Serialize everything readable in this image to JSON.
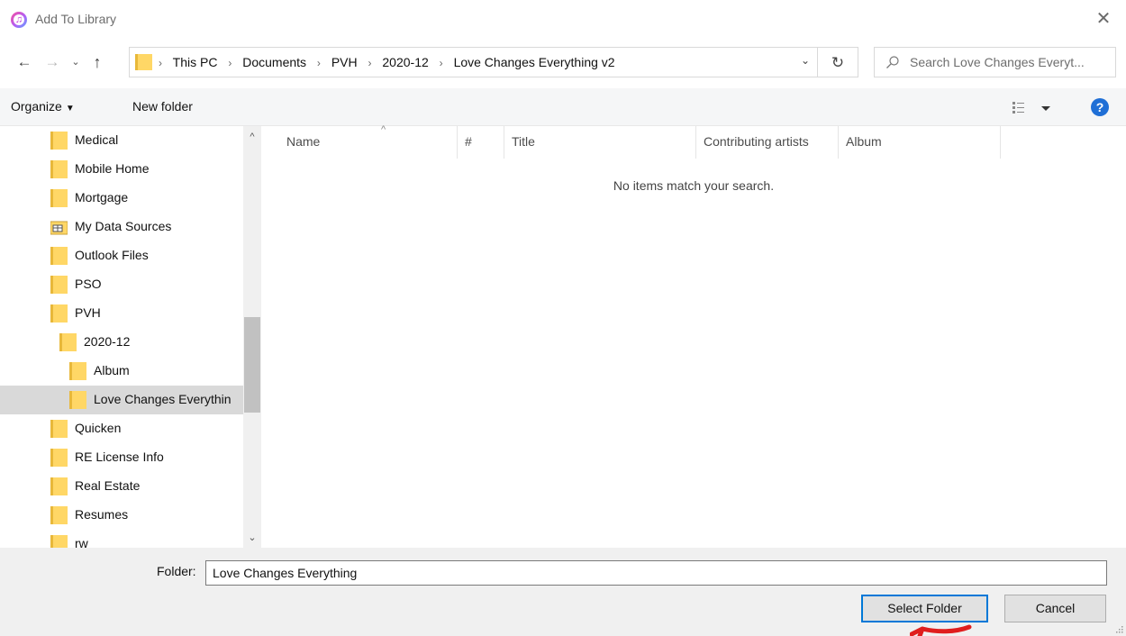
{
  "window": {
    "title": "Add To Library",
    "close_glyph": "✕"
  },
  "nav": {
    "back_glyph": "←",
    "forward_glyph": "→",
    "recent_glyph": "⌄",
    "up_glyph": "↑",
    "breadcrumbs": [
      "This PC",
      "Documents",
      "PVH",
      "2020-12",
      "Love Changes Everything v2"
    ],
    "refresh_glyph": "↻",
    "search_placeholder": "Search Love Changes Everyt..."
  },
  "toolbar": {
    "organize_label": "Organize",
    "new_folder_label": "New folder",
    "help_glyph": "?"
  },
  "tree": {
    "items": [
      {
        "label": "Medical",
        "icon": "folder-icon"
      },
      {
        "label": "Mobile Home",
        "icon": "folder-icon"
      },
      {
        "label": "Mortgage",
        "icon": "folder-icon"
      },
      {
        "label": "My Data Sources",
        "icon": "data-sources-folder-icon"
      },
      {
        "label": "Outlook Files",
        "icon": "folder-icon"
      },
      {
        "label": "PSO",
        "icon": "folder-icon"
      },
      {
        "label": "PVH",
        "icon": "folder-icon"
      },
      {
        "label": "2020-12",
        "icon": "folder-icon"
      },
      {
        "label": "Album",
        "icon": "folder-icon"
      },
      {
        "label": "Love Changes Everythin",
        "icon": "folder-icon",
        "selected": true
      },
      {
        "label": "Quicken",
        "icon": "folder-icon"
      },
      {
        "label": "RE License Info",
        "icon": "folder-icon"
      },
      {
        "label": "Real Estate",
        "icon": "folder-icon"
      },
      {
        "label": "Resumes",
        "icon": "folder-icon"
      },
      {
        "label": "rw",
        "icon": "folder-icon"
      }
    ]
  },
  "columns": {
    "name": "Name",
    "number": "#",
    "title": "Title",
    "contributing_artists": "Contributing artists",
    "album": "Album"
  },
  "content": {
    "empty_message": "No items match your search."
  },
  "footer": {
    "folder_label": "Folder:",
    "folder_value": "Love Changes Everything",
    "select_label": "Select Folder",
    "cancel_label": "Cancel"
  },
  "colors": {
    "folder_yellow": "#ffd766",
    "selection_gray": "#d9d9d9",
    "accent_blue": "#0078d7",
    "annotation_red": "#e01e1e"
  }
}
